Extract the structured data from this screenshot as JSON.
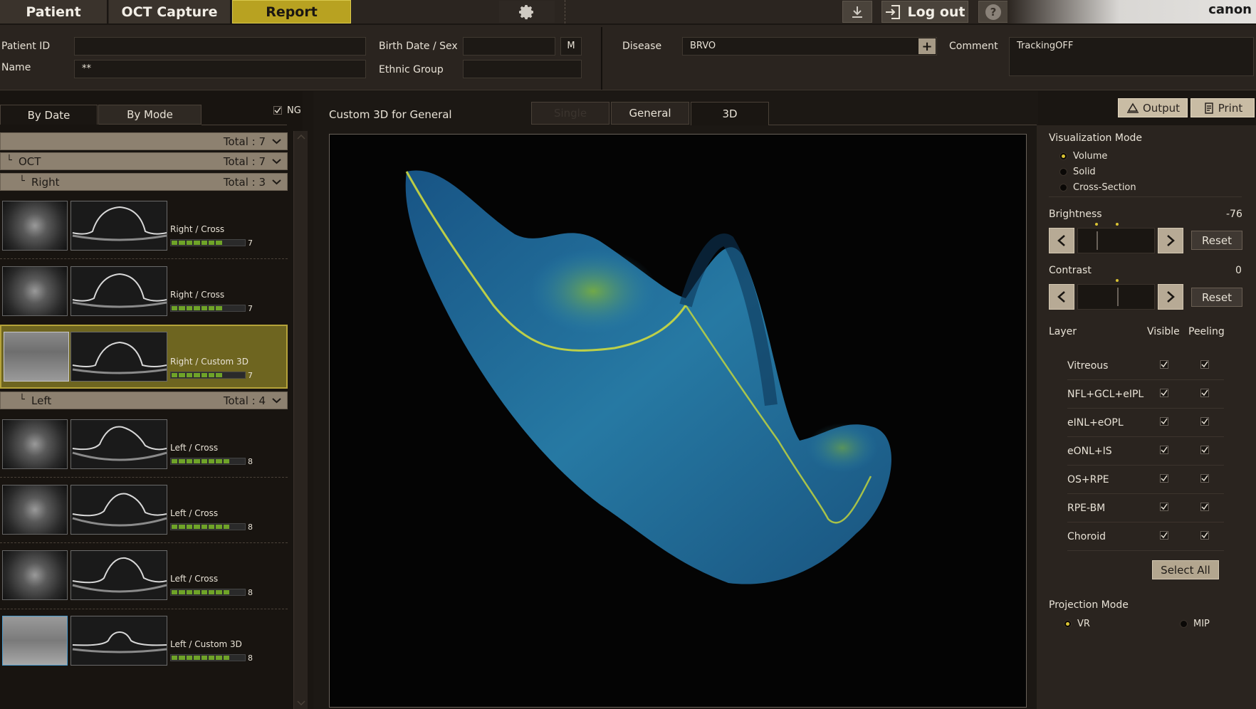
{
  "topbar": {
    "tabs": [
      {
        "label": "Patient"
      },
      {
        "label": "OCT Capture"
      },
      {
        "label": "Report"
      }
    ],
    "logout_label": "Log out",
    "help_label": "?",
    "logo": "canon"
  },
  "patient": {
    "id_label": "Patient ID",
    "id_value": "",
    "name_label": "Name",
    "name_value": "**",
    "birth_label": "Birth Date / Sex",
    "birth_value": "",
    "sex_value": "M",
    "ethnic_label": "Ethnic Group",
    "ethnic_value": "",
    "disease_label": "Disease",
    "disease_value": "BRVO",
    "comment_label": "Comment",
    "comment_value": "TrackingOFF"
  },
  "list": {
    "tabs": [
      {
        "label": "By Date"
      },
      {
        "label": "By Mode"
      }
    ],
    "ng_label": "NG",
    "groups": [
      {
        "label": "",
        "total": "Total : 7"
      },
      {
        "label": "OCT",
        "total": "Total : 7"
      },
      {
        "label": "Right",
        "total": "Total : 3"
      },
      {
        "label": "Left",
        "total": "Total : 4"
      }
    ],
    "items": [
      {
        "label": "Right / Cross",
        "quality": "7",
        "fill": 0.7
      },
      {
        "label": "Right / Cross",
        "quality": "7",
        "fill": 0.7
      },
      {
        "label": "Right / Custom 3D",
        "quality": "7",
        "fill": 0.7
      },
      {
        "label": "Left / Cross",
        "quality": "8",
        "fill": 0.8
      },
      {
        "label": "Left / Cross",
        "quality": "8",
        "fill": 0.8
      },
      {
        "label": "Left / Cross",
        "quality": "8",
        "fill": 0.8
      },
      {
        "label": "Left / Custom 3D",
        "quality": "8",
        "fill": 0.8
      }
    ]
  },
  "viewer": {
    "title": "Custom 3D for General",
    "tabs": [
      {
        "label": "Single"
      },
      {
        "label": "General"
      },
      {
        "label": "3D"
      }
    ],
    "output_label": "Output",
    "print_label": "Print"
  },
  "controls": {
    "vis_mode_title": "Visualization Mode",
    "vis_modes": [
      {
        "label": "Volume"
      },
      {
        "label": "Solid"
      },
      {
        "label": "Cross-Section"
      }
    ],
    "brightness_label": "Brightness",
    "brightness_value": "-76",
    "contrast_label": "Contrast",
    "contrast_value": "0",
    "reset_label": "Reset",
    "layer_header": "Layer",
    "visible_header": "Visible",
    "peeling_header": "Peeling",
    "layers": [
      {
        "name": "Vitreous"
      },
      {
        "name": "NFL+GCL+eIPL"
      },
      {
        "name": "eINL+eOPL"
      },
      {
        "name": "eONL+IS"
      },
      {
        "name": "OS+RPE"
      },
      {
        "name": "RPE-BM"
      },
      {
        "name": "Choroid"
      }
    ],
    "select_all_label": "Select All",
    "projection_title": "Projection Mode",
    "projection_modes": [
      {
        "label": "VR"
      },
      {
        "label": "MIP"
      }
    ]
  },
  "colors": {
    "accent": "#b8a221",
    "panel": "#2a241f",
    "volume_blue": "#1f6fa8",
    "volume_yellow": "#d8e03a"
  }
}
